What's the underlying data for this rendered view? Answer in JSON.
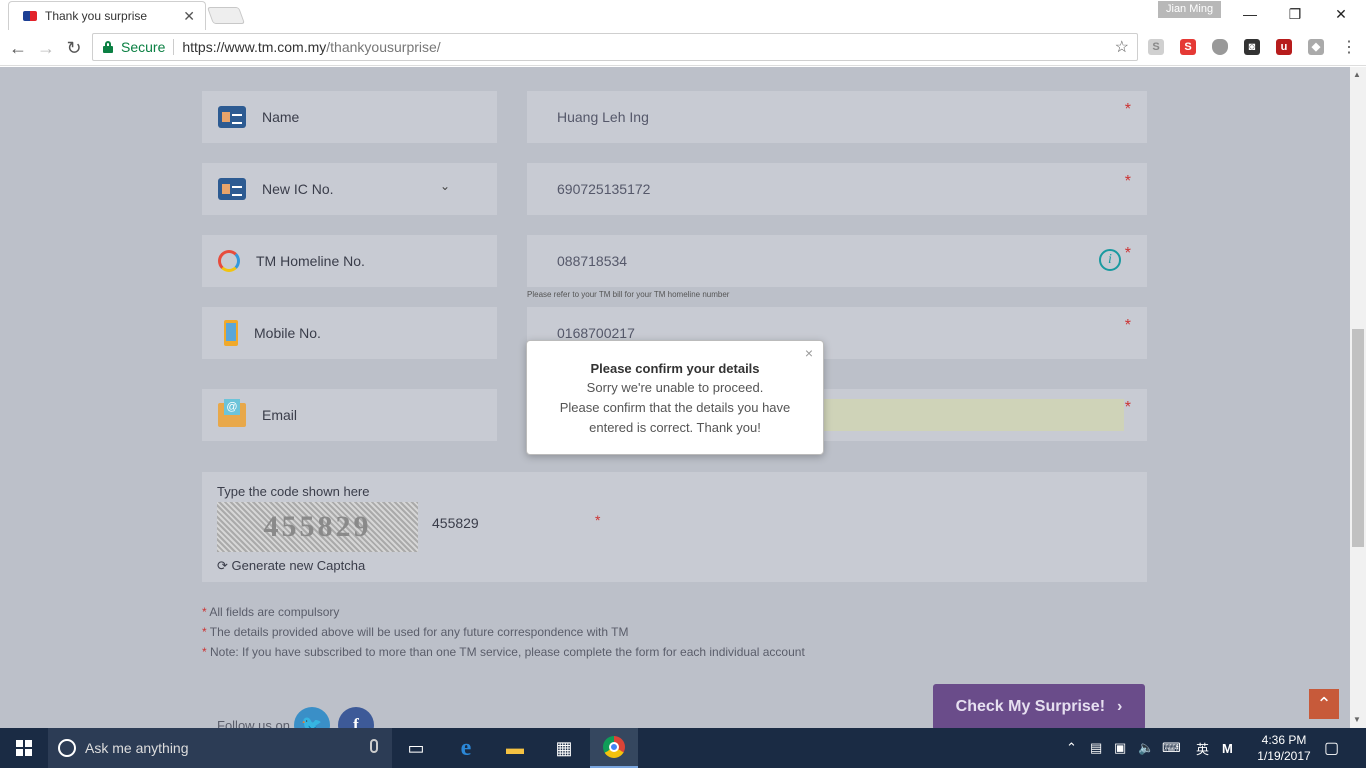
{
  "browser": {
    "tab_title": "Thank you surprise",
    "profile": "Jian Ming",
    "secure_label": "Secure",
    "url_host": "https://www.tm.com.my",
    "url_path": "/thankyousurprise/"
  },
  "form": {
    "name_label": "Name",
    "name_value": "Huang Leh Ing",
    "ic_label": "New IC No.",
    "ic_value": "690725135172",
    "homeline_label": "TM Homeline No.",
    "homeline_value": "088718534",
    "homeline_hint": "Please refer to your TM bill for your TM homeline number",
    "mobile_label": "Mobile No.",
    "mobile_value": "0168700217",
    "email_label": "Email",
    "required_mark": "*"
  },
  "captcha": {
    "label": "Type the code shown here",
    "image_text": "455829",
    "value": "455829",
    "regen_label": "Generate new Captcha"
  },
  "notes": [
    "All fields are compulsory",
    "The details provided above will be used for any future correspondence with TM",
    "Note: If you have subscribed to more than one TM service, please complete the form for each individual account"
  ],
  "footer": {
    "follow_label": "Follow us on",
    "cta_label": "Check My Surprise!"
  },
  "modal": {
    "title": "Please confirm your details",
    "line1": "Sorry we're unable to proceed.",
    "line2": "Please confirm that the details you have entered is correct. Thank you!"
  },
  "taskbar": {
    "search_placeholder": "Ask me anything",
    "time": "4:36 PM",
    "date": "1/19/2017",
    "ime": "英"
  },
  "colors": {
    "overlay_bg": "#bcc0c9",
    "cta_bg": "#6a4c8a",
    "to_top_bg": "#c75a3a",
    "secure_green": "#0b8043"
  }
}
